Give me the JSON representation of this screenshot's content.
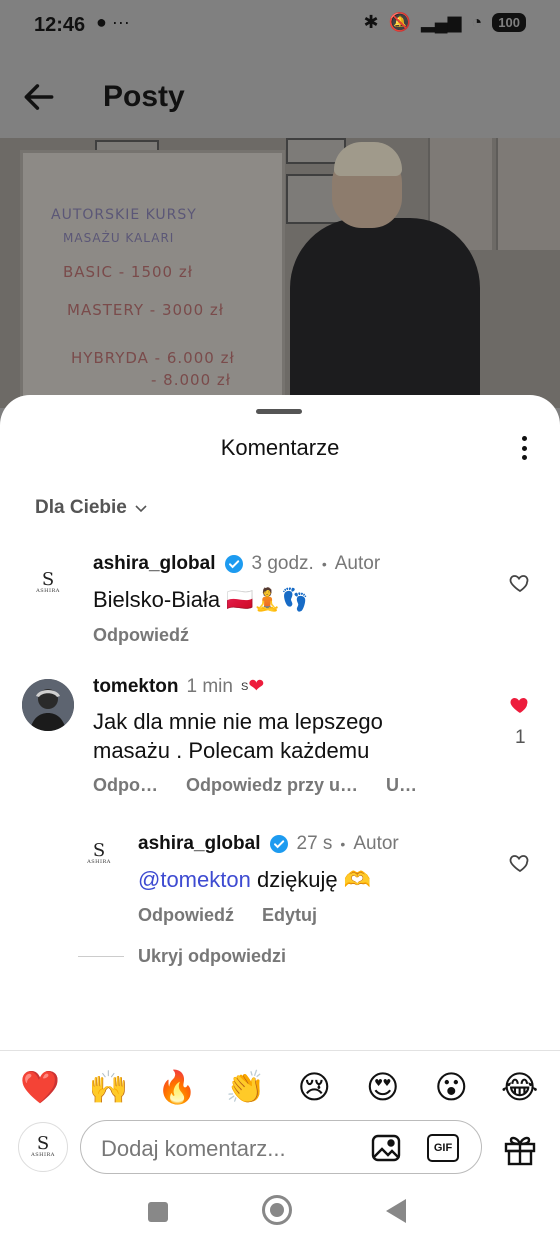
{
  "status_bar": {
    "time": "12:46",
    "notif_icons": "⚫ ···",
    "battery": "100"
  },
  "header": {
    "title": "Posty"
  },
  "post_image": {
    "board_lines": [
      "AUTORSKIE KURSY",
      "MASAŻU KALARI",
      "BASIC - 1500 zł",
      "MASTERY - 3000 zł",
      "HYBRYDA - 6.000 zł",
      "- 8.000 zł"
    ]
  },
  "sheet": {
    "title": "Komentarze",
    "filter_label": "Dla Ciebie"
  },
  "comments": [
    {
      "username": "ashira_global",
      "time": "3 godz.",
      "dot": "•",
      "author_badge": "Autor",
      "text": "Bielsko-Biała 🇵🇱🧘👣",
      "actions": [
        "Odpowiedź"
      ],
      "avatar_mark": "S",
      "avatar_text": "ASHIRA"
    },
    {
      "username": "tomekton",
      "time": "1 min",
      "liked_by_author": "❤",
      "text_line1": "Jak dla mnie nie ma lepszego",
      "text_line2": "masażu . Polecam każdemu",
      "actions": [
        "Odpo…",
        "Odpowiedz przy u…",
        "U…"
      ],
      "like_count": "1"
    },
    {
      "username": "ashira_global",
      "time": "27 s",
      "dot": "•",
      "author_badge": "Autor",
      "mention": "@tomekton",
      "text": "dziękuję 🫶",
      "actions": [
        "Odpowiedź",
        "Edytuj"
      ],
      "avatar_mark": "S",
      "avatar_text": "ASHIRA"
    }
  ],
  "hide_replies": "Ukryj odpowiedzi",
  "emoji_bar": [
    "❤️",
    "🙌",
    "🔥",
    "👏",
    "😢",
    "😍",
    "😮",
    "😂"
  ],
  "composer": {
    "placeholder": "Dodaj komentarz...",
    "gif_label": "GIF",
    "avatar_mark": "S",
    "avatar_text": "ASHIRA"
  },
  "colors": {
    "like_red": "#ed1c3c",
    "mention_blue": "#3e4bd1",
    "verified_blue": "#1d9bf0"
  }
}
